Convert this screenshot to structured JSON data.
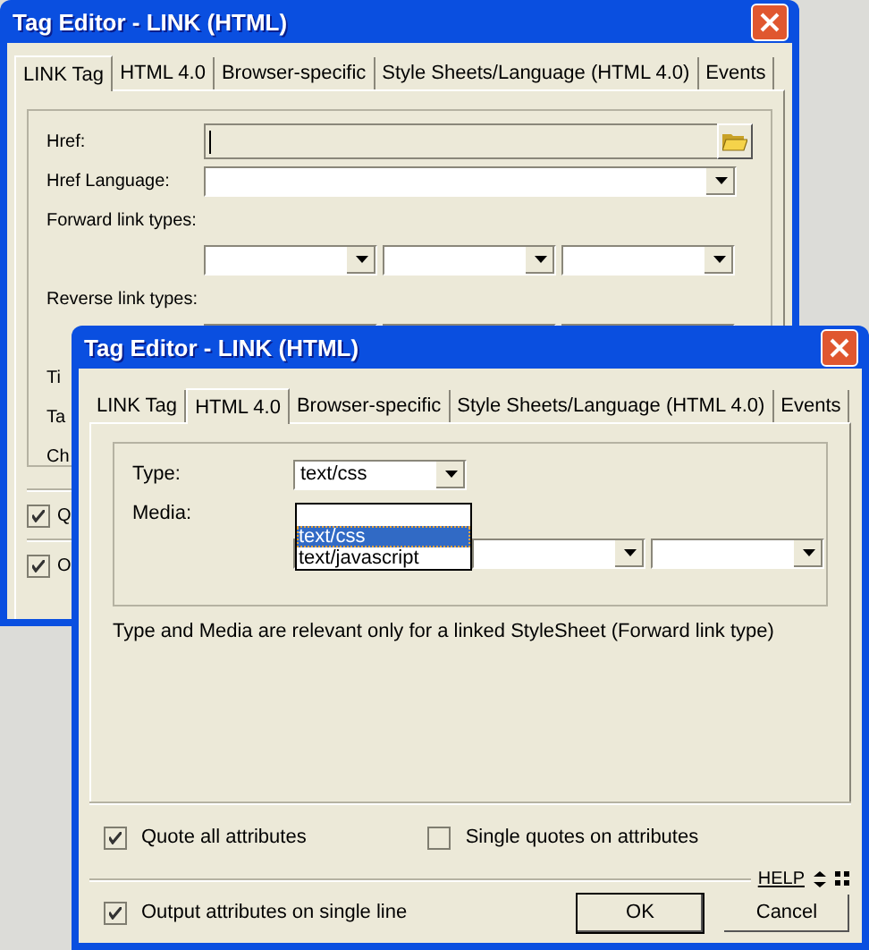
{
  "back_window": {
    "title": "Tag Editor - LINK (HTML)",
    "tabs": [
      {
        "label": "LINK Tag",
        "selected": true
      },
      {
        "label": "HTML 4.0",
        "selected": false
      },
      {
        "label": "Browser-specific",
        "selected": false
      },
      {
        "label": "Style Sheets/Language (HTML 4.0)",
        "selected": false
      },
      {
        "label": "Events",
        "selected": false
      }
    ],
    "fields": [
      {
        "label": "Href:",
        "kind": "browse"
      },
      {
        "label": "Href Language:",
        "kind": "combo"
      }
    ],
    "link_types": [
      {
        "label": "Forward link types:"
      },
      {
        "label": "Reverse link types:"
      }
    ],
    "cut_labels": [
      "Ti",
      "Ta",
      "Ch"
    ],
    "checkboxes": [
      {
        "label": "Q",
        "checked": true
      },
      {
        "label": "O",
        "checked": true
      }
    ]
  },
  "front_window": {
    "title": "Tag Editor - LINK (HTML)",
    "tabs": [
      {
        "label": "LINK Tag",
        "selected": false
      },
      {
        "label": "HTML 4.0",
        "selected": true
      },
      {
        "label": "Browser-specific",
        "selected": false
      },
      {
        "label": "Style Sheets/Language (HTML 4.0)",
        "selected": false
      },
      {
        "label": "Events",
        "selected": false
      }
    ],
    "type": {
      "label": "Type:",
      "value": "text/css"
    },
    "type_options": [
      {
        "label": "text/css",
        "selected": true
      },
      {
        "label": "text/javascript",
        "selected": false
      }
    ],
    "media": {
      "label": "Media:"
    },
    "note": "Type and Media are relevant only for a linked StyleSheet (Forward link type)",
    "checkboxes": [
      {
        "label": "Quote all attributes",
        "checked": true
      },
      {
        "label": "Single quotes on attributes",
        "checked": false
      }
    ],
    "line_checkbox": {
      "label": "Output attributes on single line",
      "checked": true
    },
    "help": "HELP",
    "buttons": [
      "OK",
      "Cancel"
    ]
  }
}
